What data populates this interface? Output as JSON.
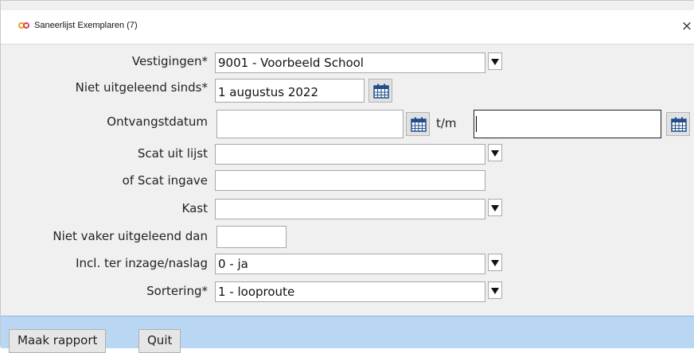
{
  "window": {
    "title": "Saneerlijst Exemplaren (7)",
    "close_glyph": "×"
  },
  "form": {
    "vestigingen": {
      "label": "Vestigingen*",
      "value": "9001 - Voorbeeld School"
    },
    "niet_uitgeleend_sinds": {
      "label": "Niet uitgeleend sinds*",
      "value": "1 augustus 2022"
    },
    "ontvangstdatum": {
      "label": "Ontvangstdatum",
      "value_from": "",
      "separator": "t/m",
      "value_to": ""
    },
    "scat_uit_lijst": {
      "label": "Scat uit lijst",
      "value": ""
    },
    "scat_ingave": {
      "label": "of Scat ingave",
      "value": ""
    },
    "kast": {
      "label": "Kast",
      "value": ""
    },
    "niet_vaker": {
      "label": "Niet vaker uitgeleend dan",
      "value": ""
    },
    "incl_ter_inzage": {
      "label": "Incl. ter inzage/naslag",
      "value": "0 - ja"
    },
    "sortering": {
      "label": "Sortering*",
      "value": "1 - looproute"
    }
  },
  "footer": {
    "maak_rapport": "Maak rapport",
    "quit": "Quit"
  },
  "icons": {
    "app": "infinity-icon",
    "calendar": "calendar-icon",
    "dropdown": "dropdown-arrow-icon",
    "close": "close-icon"
  }
}
